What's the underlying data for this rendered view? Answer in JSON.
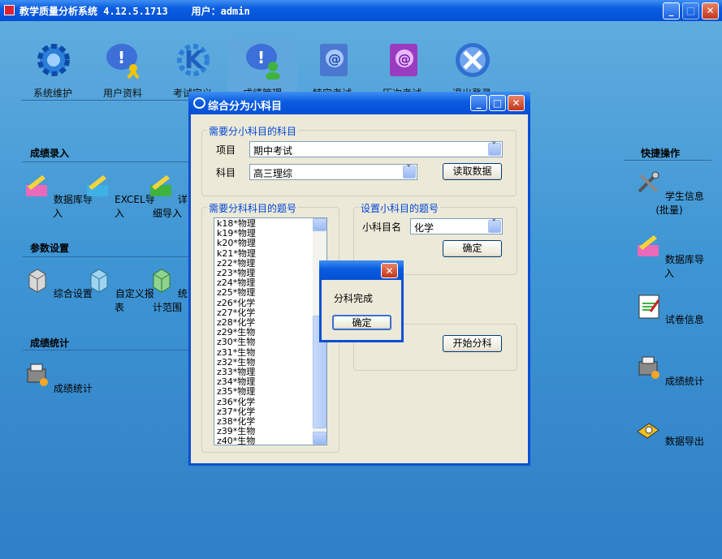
{
  "app": {
    "title": "教学质量分析系统 4.12.5.1713    用户：admin"
  },
  "toolbar": {
    "items": [
      {
        "label": "系统维护",
        "icon": "gear-icon"
      },
      {
        "label": "用户资料",
        "icon": "user-alert-icon"
      },
      {
        "label": "考试定义",
        "icon": "k-icon"
      },
      {
        "label": "成绩管理",
        "icon": "user-alert-icon"
      },
      {
        "label": "特定考试",
        "icon": "at-book-icon"
      },
      {
        "label": "历次考试",
        "icon": "at-book-icon"
      },
      {
        "label": "退出登录",
        "icon": "exit-icon"
      }
    ]
  },
  "left": {
    "sections": [
      {
        "title": "成绩录入",
        "items": [
          "数据库导入",
          "EXCEL导入",
          "详细导入"
        ]
      },
      {
        "title": "参数设置",
        "items": [
          "综合设置",
          "自定义报表",
          "统计范围"
        ]
      },
      {
        "title": "成绩统计",
        "items": [
          "成绩统计"
        ]
      }
    ]
  },
  "right": {
    "title": "快捷操作",
    "items": [
      "学生信息(批量)",
      "数据库导入",
      "试卷信息",
      "成绩统计",
      "数据导出"
    ]
  },
  "dialog": {
    "title": "综合分为小科目",
    "group1": {
      "label": "需要分小科目的科目",
      "project_label": "项目",
      "project_value": "期中考试",
      "subject_label": "科目",
      "subject_value": "高三理综",
      "read_button": "读取数据"
    },
    "group2": {
      "label": "需要分科科目的题号",
      "items": [
        "k18*物理",
        "k19*物理",
        "k20*物理",
        "k21*物理",
        "z22*物理",
        "z23*物理",
        "z24*物理",
        "z25*物理",
        "z26*化学",
        "z27*化学",
        "z28*化学",
        "z29*生物",
        "z30*生物",
        "z31*生物",
        "z32*生物",
        "z33*物理",
        "z34*物理",
        "z35*物理",
        "z36*化学",
        "z37*化学",
        "z38*化学",
        "z39*生物",
        "z40*生物"
      ]
    },
    "group3": {
      "label": "设置小科目的题号",
      "name_label": "小科目名",
      "name_value": "化学",
      "ok_button": "确定"
    },
    "start_button": "开始分科"
  },
  "msgbox": {
    "text": "分科完成",
    "ok": "确定"
  }
}
